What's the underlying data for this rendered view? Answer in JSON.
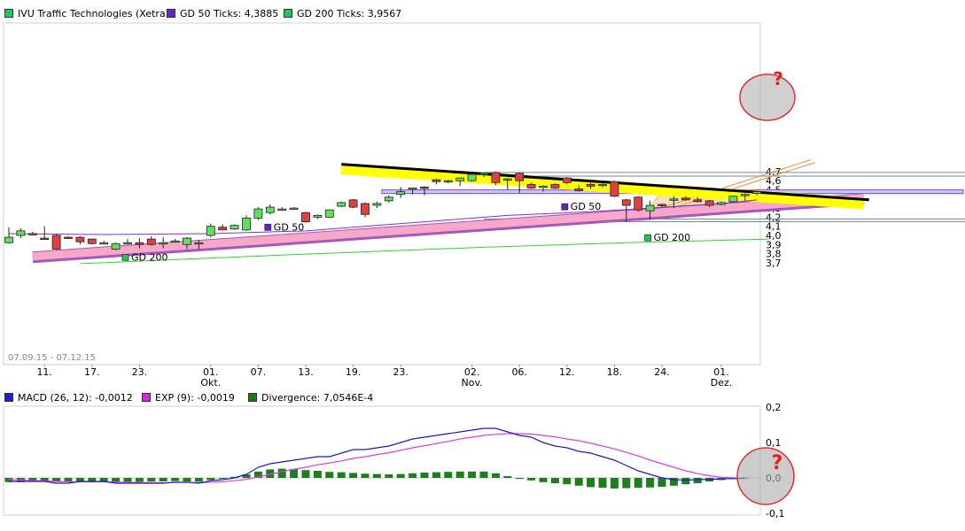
{
  "legend_top": [
    {
      "label": "IVU Traffic Technologies (Xetra)",
      "color": "#22c55e"
    },
    {
      "label": "GD 50 Ticks: 4,3885",
      "color": "#6a1fd1"
    },
    {
      "label": "GD 200 Ticks: 3,9567",
      "color": "#22c55e"
    }
  ],
  "legend_bottom": [
    {
      "label": "MACD (26, 12): -0,0012",
      "color": "#1d1dcc"
    },
    {
      "label": "EXP (9): -0,0019",
      "color": "#e020e0"
    },
    {
      "label": "Divergence: 7,0546E-4",
      "color": "#1a7a1a"
    }
  ],
  "date_range": "07.09.15 - 07.12.15",
  "ma_labels": [
    {
      "text": "GD 50",
      "color": "#6a1fd1",
      "day": 22,
      "v": 4.055
    },
    {
      "text": "GD 50",
      "color": "#6a1fd1",
      "day": 47,
      "v": 4.28
    },
    {
      "text": "GD 200",
      "color": "#22c55e",
      "day": 10,
      "v": 3.725
    },
    {
      "text": "GD 200",
      "color": "#22c55e",
      "day": 54,
      "v": 3.94
    }
  ],
  "question_marks": [
    "?",
    "?"
  ],
  "colors": {
    "up": "#5de25d",
    "down": "#e04040",
    "gd50": "#7a2ee8",
    "gd200": "#2ed62e",
    "macd": "#1a1ac8",
    "exp": "#e43ae4",
    "div": "#1e7e1e",
    "yellow": "#ffff00",
    "pink": "#f7a8c8",
    "zone": "#a8d8ee",
    "cone": "#f3deaa"
  },
  "chart_data": [
    {
      "type": "candlestick",
      "title": "IVU Traffic Technologies (Xetra)",
      "ylim": [
        3.6,
        4.8
      ],
      "yticks": [
        "3,7",
        "3,8",
        "3,9",
        "4,0",
        "4,1",
        "4,2",
        "4,3",
        "4,4",
        "4,5",
        "4,6",
        "4,7"
      ],
      "ytick_values": [
        3.7,
        3.8,
        3.9,
        4.0,
        4.1,
        4.2,
        4.3,
        4.4,
        4.5,
        4.6,
        4.7
      ],
      "xticks": [
        {
          "day": 3,
          "label": "11."
        },
        {
          "day": 7,
          "label": "17."
        },
        {
          "day": 11,
          "label": "23."
        },
        {
          "day": 17,
          "label": "01.",
          "sub": "Okt."
        },
        {
          "day": 21,
          "label": "07."
        },
        {
          "day": 25,
          "label": "13."
        },
        {
          "day": 29,
          "label": "19."
        },
        {
          "day": 33,
          "label": "23."
        },
        {
          "day": 39,
          "label": "02.",
          "sub": "Nov."
        },
        {
          "day": 43,
          "label": "06."
        },
        {
          "day": 47,
          "label": "12."
        },
        {
          "day": 51,
          "label": "18."
        },
        {
          "day": 55,
          "label": "24."
        },
        {
          "day": 60,
          "label": "01.",
          "sub": "Dez."
        }
      ],
      "candles": [
        {
          "o": 3.92,
          "h": 4.09,
          "l": 3.91,
          "c": 3.98
        },
        {
          "o": 4.0,
          "h": 4.08,
          "l": 3.97,
          "c": 4.05
        },
        {
          "o": 4.02,
          "h": 4.04,
          "l": 4.0,
          "c": 4.01
        },
        {
          "o": 3.97,
          "h": 4.1,
          "l": 3.95,
          "c": 3.96
        },
        {
          "o": 4.0,
          "h": 4.01,
          "l": 3.84,
          "c": 3.85
        },
        {
          "o": 3.98,
          "h": 3.99,
          "l": 3.96,
          "c": 3.97
        },
        {
          "o": 3.98,
          "h": 3.99,
          "l": 3.9,
          "c": 3.93
        },
        {
          "o": 3.96,
          "h": 3.96,
          "l": 3.9,
          "c": 3.91
        },
        {
          "o": 3.92,
          "h": 3.94,
          "l": 3.9,
          "c": 3.92
        },
        {
          "o": 3.85,
          "h": 3.92,
          "l": 3.84,
          "c": 3.91
        },
        {
          "o": 3.92,
          "h": 3.96,
          "l": 3.9,
          "c": 3.92
        },
        {
          "o": 3.92,
          "h": 3.97,
          "l": 3.86,
          "c": 3.9
        },
        {
          "o": 3.96,
          "h": 3.99,
          "l": 3.89,
          "c": 3.9
        },
        {
          "o": 3.91,
          "h": 3.98,
          "l": 3.86,
          "c": 3.92
        },
        {
          "o": 3.94,
          "h": 3.96,
          "l": 3.92,
          "c": 3.94
        },
        {
          "o": 3.9,
          "h": 3.98,
          "l": 3.85,
          "c": 3.97
        },
        {
          "o": 3.92,
          "h": 3.95,
          "l": 3.85,
          "c": 3.92
        },
        {
          "o": 4.0,
          "h": 4.13,
          "l": 3.98,
          "c": 4.1
        },
        {
          "o": 4.09,
          "h": 4.12,
          "l": 4.06,
          "c": 4.06
        },
        {
          "o": 4.07,
          "h": 4.12,
          "l": 4.06,
          "c": 4.11
        },
        {
          "o": 4.06,
          "h": 4.22,
          "l": 4.05,
          "c": 4.19
        },
        {
          "o": 4.19,
          "h": 4.31,
          "l": 4.17,
          "c": 4.29
        },
        {
          "o": 4.25,
          "h": 4.34,
          "l": 4.23,
          "c": 4.31
        },
        {
          "o": 4.29,
          "h": 4.31,
          "l": 4.28,
          "c": 4.29
        },
        {
          "o": 4.3,
          "h": 4.31,
          "l": 4.29,
          "c": 4.3
        },
        {
          "o": 4.25,
          "h": 4.26,
          "l": 4.14,
          "c": 4.15
        },
        {
          "o": 4.2,
          "h": 4.23,
          "l": 4.18,
          "c": 4.22
        },
        {
          "o": 4.2,
          "h": 4.28,
          "l": 4.19,
          "c": 4.28
        },
        {
          "o": 4.32,
          "h": 4.37,
          "l": 4.31,
          "c": 4.36
        },
        {
          "o": 4.39,
          "h": 4.4,
          "l": 4.3,
          "c": 4.31
        },
        {
          "o": 4.35,
          "h": 4.36,
          "l": 4.2,
          "c": 4.23
        },
        {
          "o": 4.33,
          "h": 4.37,
          "l": 4.3,
          "c": 4.35
        },
        {
          "o": 4.38,
          "h": 4.44,
          "l": 4.36,
          "c": 4.42
        },
        {
          "o": 4.45,
          "h": 4.53,
          "l": 4.41,
          "c": 4.48
        },
        {
          "o": 4.51,
          "h": 4.52,
          "l": 4.45,
          "c": 4.52
        },
        {
          "o": 4.53,
          "h": 4.54,
          "l": 4.44,
          "c": 4.52
        },
        {
          "o": 4.61,
          "h": 4.62,
          "l": 4.56,
          "c": 4.59
        },
        {
          "o": 4.6,
          "h": 4.61,
          "l": 4.57,
          "c": 4.6
        },
        {
          "o": 4.6,
          "h": 4.62,
          "l": 4.54,
          "c": 4.63
        },
        {
          "o": 4.6,
          "h": 4.69,
          "l": 4.59,
          "c": 4.67
        },
        {
          "o": 4.68,
          "h": 4.69,
          "l": 4.64,
          "c": 4.68
        },
        {
          "o": 4.69,
          "h": 4.7,
          "l": 4.55,
          "c": 4.58
        },
        {
          "o": 4.61,
          "h": 4.63,
          "l": 4.5,
          "c": 4.62
        },
        {
          "o": 4.68,
          "h": 4.69,
          "l": 4.46,
          "c": 4.6
        },
        {
          "o": 4.56,
          "h": 4.58,
          "l": 4.51,
          "c": 4.52
        },
        {
          "o": 4.53,
          "h": 4.55,
          "l": 4.48,
          "c": 4.54
        },
        {
          "o": 4.56,
          "h": 4.57,
          "l": 4.51,
          "c": 4.52
        },
        {
          "o": 4.63,
          "h": 4.64,
          "l": 4.56,
          "c": 4.58
        },
        {
          "o": 4.51,
          "h": 4.55,
          "l": 4.48,
          "c": 4.49
        },
        {
          "o": 4.56,
          "h": 4.58,
          "l": 4.51,
          "c": 4.54
        },
        {
          "o": 4.56,
          "h": 4.57,
          "l": 4.53,
          "c": 4.56
        },
        {
          "o": 4.59,
          "h": 4.6,
          "l": 4.42,
          "c": 4.43
        },
        {
          "o": 4.39,
          "h": 4.4,
          "l": 4.15,
          "c": 4.33
        },
        {
          "o": 4.42,
          "h": 4.43,
          "l": 4.26,
          "c": 4.28
        },
        {
          "o": 4.27,
          "h": 4.38,
          "l": 4.17,
          "c": 4.33
        },
        {
          "o": 4.34,
          "h": 4.35,
          "l": 4.31,
          "c": 4.33
        },
        {
          "o": 4.4,
          "h": 4.43,
          "l": 4.3,
          "c": 4.4
        },
        {
          "o": 4.41,
          "h": 4.43,
          "l": 4.38,
          "c": 4.39
        },
        {
          "o": 4.39,
          "h": 4.42,
          "l": 4.36,
          "c": 4.37
        },
        {
          "o": 4.38,
          "h": 4.39,
          "l": 4.31,
          "c": 4.33
        },
        {
          "o": 4.34,
          "h": 4.37,
          "l": 4.33,
          "c": 4.36
        },
        {
          "o": 4.37,
          "h": 4.4,
          "l": 4.36,
          "c": 4.43
        },
        {
          "o": 4.45,
          "h": 4.46,
          "l": 4.38,
          "c": 4.45
        },
        {
          "o": 4.46,
          "h": 4.48,
          "l": 4.44,
          "c": 4.48
        }
      ],
      "gd50": [
        {
          "day": 0,
          "v": 4.02
        },
        {
          "day": 8,
          "v": 4.01
        },
        {
          "day": 17,
          "v": 4.02
        },
        {
          "day": 25,
          "v": 4.05
        },
        {
          "day": 33,
          "v": 4.13
        },
        {
          "day": 42,
          "v": 4.22
        },
        {
          "day": 49,
          "v": 4.26
        },
        {
          "day": 54,
          "v": 4.3
        },
        {
          "day": 60,
          "v": 4.35
        },
        {
          "day": 63,
          "v": 4.39
        }
      ],
      "gd200": [
        {
          "day": 6,
          "v": 3.69
        },
        {
          "day": 24,
          "v": 3.79
        },
        {
          "day": 40,
          "v": 3.87
        },
        {
          "day": 52,
          "v": 3.92
        },
        {
          "day": 64,
          "v": 3.96
        }
      ],
      "hlines": [
        4.69,
        4.65,
        4.18,
        4.15
      ],
      "resistance_zone": [
        4.46,
        4.5
      ],
      "trend_yellow": {
        "from": {
          "day": 28,
          "v": 4.78
        },
        "to": {
          "day": 72,
          "v": 4.4
        }
      },
      "trend_pink": {
        "from": {
          "day": 2,
          "v": 3.76
        },
        "to": {
          "day": 72,
          "v": 4.4
        }
      }
    },
    {
      "type": "macd",
      "title": "MACD (26, 12)",
      "ylim": [
        -0.1,
        0.2
      ],
      "yticks": [
        "-0,1",
        "0,0",
        "0,1",
        "0,2"
      ],
      "ytick_values": [
        -0.1,
        0.0,
        0.1,
        0.2
      ],
      "macd": [
        -0.01,
        -0.01,
        -0.01,
        -0.01,
        -0.015,
        -0.015,
        -0.01,
        -0.01,
        -0.01,
        -0.015,
        -0.015,
        -0.015,
        -0.015,
        -0.015,
        -0.012,
        -0.012,
        -0.015,
        -0.008,
        -0.005,
        0.0,
        0.01,
        0.03,
        0.04,
        0.045,
        0.05,
        0.055,
        0.06,
        0.06,
        0.07,
        0.08,
        0.08,
        0.085,
        0.09,
        0.1,
        0.11,
        0.115,
        0.12,
        0.125,
        0.13,
        0.135,
        0.14,
        0.14,
        0.13,
        0.12,
        0.115,
        0.1,
        0.09,
        0.085,
        0.075,
        0.07,
        0.06,
        0.05,
        0.035,
        0.02,
        0.01,
        0.0,
        -0.005,
        -0.006,
        -0.005,
        -0.004,
        -0.003,
        -0.002,
        -0.001
      ],
      "exp": [
        -0.005,
        -0.006,
        -0.007,
        -0.008,
        -0.01,
        -0.011,
        -0.011,
        -0.011,
        -0.011,
        -0.012,
        -0.012,
        -0.013,
        -0.013,
        -0.014,
        -0.013,
        -0.013,
        -0.014,
        -0.012,
        -0.011,
        -0.008,
        -0.004,
        0.003,
        0.01,
        0.018,
        0.024,
        0.03,
        0.037,
        0.042,
        0.048,
        0.055,
        0.06,
        0.066,
        0.071,
        0.078,
        0.085,
        0.091,
        0.097,
        0.103,
        0.11,
        0.115,
        0.12,
        0.123,
        0.125,
        0.125,
        0.124,
        0.12,
        0.116,
        0.11,
        0.105,
        0.098,
        0.09,
        0.082,
        0.072,
        0.062,
        0.05,
        0.04,
        0.03,
        0.02,
        0.012,
        0.006,
        0.002,
        0.0,
        -0.002
      ],
      "divergence": [
        -0.012,
        -0.012,
        -0.011,
        -0.01,
        -0.01,
        -0.01,
        -0.01,
        -0.009,
        -0.01,
        -0.011,
        -0.011,
        -0.011,
        -0.01,
        -0.01,
        -0.009,
        -0.01,
        -0.011,
        -0.006,
        -0.002,
        0.003,
        0.01,
        0.018,
        0.024,
        0.026,
        0.025,
        0.022,
        0.02,
        0.017,
        0.016,
        0.014,
        0.012,
        0.011,
        0.01,
        0.011,
        0.013,
        0.015,
        0.016,
        0.017,
        0.018,
        0.018,
        0.018,
        0.013,
        0.005,
        -0.003,
        -0.007,
        -0.012,
        -0.015,
        -0.018,
        -0.022,
        -0.026,
        -0.028,
        -0.03,
        -0.029,
        -0.028,
        -0.027,
        -0.025,
        -0.022,
        -0.018,
        -0.015,
        -0.01,
        -0.006,
        -0.003,
        0.001
      ]
    }
  ]
}
